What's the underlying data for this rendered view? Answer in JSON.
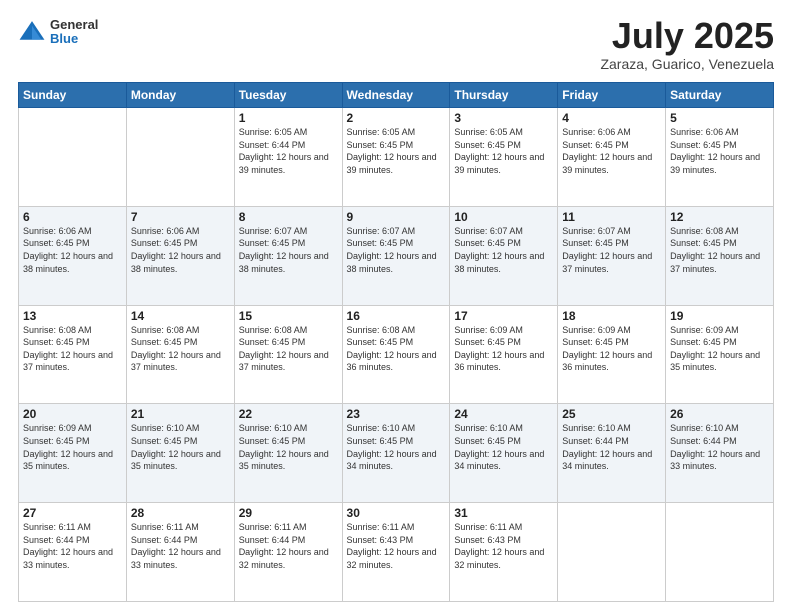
{
  "header": {
    "logo": {
      "general": "General",
      "blue": "Blue"
    },
    "title": "July 2025",
    "subtitle": "Zaraza, Guarico, Venezuela"
  },
  "days_header": [
    "Sunday",
    "Monday",
    "Tuesday",
    "Wednesday",
    "Thursday",
    "Friday",
    "Saturday"
  ],
  "weeks": [
    [
      {
        "num": "",
        "info": ""
      },
      {
        "num": "",
        "info": ""
      },
      {
        "num": "1",
        "info": "Sunrise: 6:05 AM\nSunset: 6:44 PM\nDaylight: 12 hours and 39 minutes."
      },
      {
        "num": "2",
        "info": "Sunrise: 6:05 AM\nSunset: 6:45 PM\nDaylight: 12 hours and 39 minutes."
      },
      {
        "num": "3",
        "info": "Sunrise: 6:05 AM\nSunset: 6:45 PM\nDaylight: 12 hours and 39 minutes."
      },
      {
        "num": "4",
        "info": "Sunrise: 6:06 AM\nSunset: 6:45 PM\nDaylight: 12 hours and 39 minutes."
      },
      {
        "num": "5",
        "info": "Sunrise: 6:06 AM\nSunset: 6:45 PM\nDaylight: 12 hours and 39 minutes."
      }
    ],
    [
      {
        "num": "6",
        "info": "Sunrise: 6:06 AM\nSunset: 6:45 PM\nDaylight: 12 hours and 38 minutes."
      },
      {
        "num": "7",
        "info": "Sunrise: 6:06 AM\nSunset: 6:45 PM\nDaylight: 12 hours and 38 minutes."
      },
      {
        "num": "8",
        "info": "Sunrise: 6:07 AM\nSunset: 6:45 PM\nDaylight: 12 hours and 38 minutes."
      },
      {
        "num": "9",
        "info": "Sunrise: 6:07 AM\nSunset: 6:45 PM\nDaylight: 12 hours and 38 minutes."
      },
      {
        "num": "10",
        "info": "Sunrise: 6:07 AM\nSunset: 6:45 PM\nDaylight: 12 hours and 38 minutes."
      },
      {
        "num": "11",
        "info": "Sunrise: 6:07 AM\nSunset: 6:45 PM\nDaylight: 12 hours and 37 minutes."
      },
      {
        "num": "12",
        "info": "Sunrise: 6:08 AM\nSunset: 6:45 PM\nDaylight: 12 hours and 37 minutes."
      }
    ],
    [
      {
        "num": "13",
        "info": "Sunrise: 6:08 AM\nSunset: 6:45 PM\nDaylight: 12 hours and 37 minutes."
      },
      {
        "num": "14",
        "info": "Sunrise: 6:08 AM\nSunset: 6:45 PM\nDaylight: 12 hours and 37 minutes."
      },
      {
        "num": "15",
        "info": "Sunrise: 6:08 AM\nSunset: 6:45 PM\nDaylight: 12 hours and 37 minutes."
      },
      {
        "num": "16",
        "info": "Sunrise: 6:08 AM\nSunset: 6:45 PM\nDaylight: 12 hours and 36 minutes."
      },
      {
        "num": "17",
        "info": "Sunrise: 6:09 AM\nSunset: 6:45 PM\nDaylight: 12 hours and 36 minutes."
      },
      {
        "num": "18",
        "info": "Sunrise: 6:09 AM\nSunset: 6:45 PM\nDaylight: 12 hours and 36 minutes."
      },
      {
        "num": "19",
        "info": "Sunrise: 6:09 AM\nSunset: 6:45 PM\nDaylight: 12 hours and 35 minutes."
      }
    ],
    [
      {
        "num": "20",
        "info": "Sunrise: 6:09 AM\nSunset: 6:45 PM\nDaylight: 12 hours and 35 minutes."
      },
      {
        "num": "21",
        "info": "Sunrise: 6:10 AM\nSunset: 6:45 PM\nDaylight: 12 hours and 35 minutes."
      },
      {
        "num": "22",
        "info": "Sunrise: 6:10 AM\nSunset: 6:45 PM\nDaylight: 12 hours and 35 minutes."
      },
      {
        "num": "23",
        "info": "Sunrise: 6:10 AM\nSunset: 6:45 PM\nDaylight: 12 hours and 34 minutes."
      },
      {
        "num": "24",
        "info": "Sunrise: 6:10 AM\nSunset: 6:45 PM\nDaylight: 12 hours and 34 minutes."
      },
      {
        "num": "25",
        "info": "Sunrise: 6:10 AM\nSunset: 6:44 PM\nDaylight: 12 hours and 34 minutes."
      },
      {
        "num": "26",
        "info": "Sunrise: 6:10 AM\nSunset: 6:44 PM\nDaylight: 12 hours and 33 minutes."
      }
    ],
    [
      {
        "num": "27",
        "info": "Sunrise: 6:11 AM\nSunset: 6:44 PM\nDaylight: 12 hours and 33 minutes."
      },
      {
        "num": "28",
        "info": "Sunrise: 6:11 AM\nSunset: 6:44 PM\nDaylight: 12 hours and 33 minutes."
      },
      {
        "num": "29",
        "info": "Sunrise: 6:11 AM\nSunset: 6:44 PM\nDaylight: 12 hours and 32 minutes."
      },
      {
        "num": "30",
        "info": "Sunrise: 6:11 AM\nSunset: 6:43 PM\nDaylight: 12 hours and 32 minutes."
      },
      {
        "num": "31",
        "info": "Sunrise: 6:11 AM\nSunset: 6:43 PM\nDaylight: 12 hours and 32 minutes."
      },
      {
        "num": "",
        "info": ""
      },
      {
        "num": "",
        "info": ""
      }
    ]
  ]
}
